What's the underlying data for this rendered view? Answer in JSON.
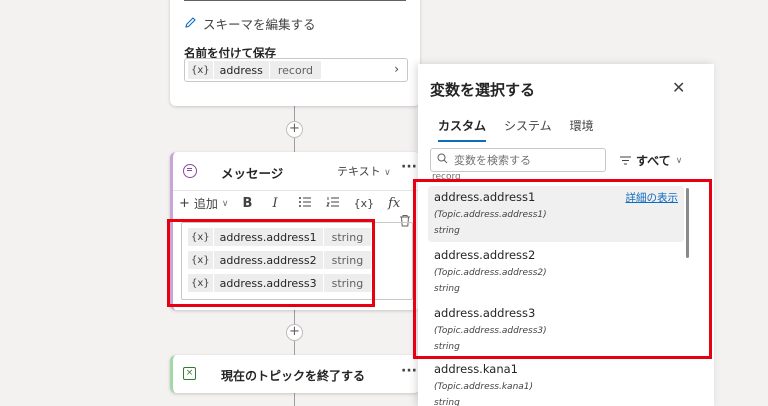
{
  "top_card": {
    "edit_schema_label": "スキーマを編集する",
    "save_as_label": "名前を付けて保存",
    "variable_icon": "{x}",
    "variable_name": "address",
    "variable_type": "record"
  },
  "message_card": {
    "title": "メッセージ",
    "type_selector": "テキスト",
    "more": "···",
    "toolbar": {
      "add_label": "追加",
      "bold": "B",
      "italic": "I",
      "variable": "{x}",
      "formula": "fx"
    },
    "variables": [
      {
        "icon": "{x}",
        "name": "address.address1",
        "type": "string"
      },
      {
        "icon": "{x}",
        "name": "address.address2",
        "type": "string"
      },
      {
        "icon": "{x}",
        "name": "address.address3",
        "type": "string"
      }
    ]
  },
  "end_card": {
    "title": "現在のトピックを終了する",
    "more": "···"
  },
  "panel": {
    "title": "変数を選択する",
    "tabs": [
      "カスタム",
      "システム",
      "環境"
    ],
    "active_tab": "カスタム",
    "search_placeholder": "変数を検索する",
    "filter_label": "すべて",
    "cut_text": "record",
    "detail_link": "詳細の表示",
    "items": [
      {
        "name": "address.address1",
        "path": "(Topic.address.address1)",
        "type": "string"
      },
      {
        "name": "address.address2",
        "path": "(Topic.address.address2)",
        "type": "string"
      },
      {
        "name": "address.address3",
        "path": "(Topic.address.address3)",
        "type": "string"
      },
      {
        "name": "address.kana1",
        "path": "(Topic.address.kana1)",
        "type": "string"
      }
    ]
  },
  "colors": {
    "highlight": "#e60012",
    "accent": "#0f6cbd",
    "message_accent": "#c9a5d6",
    "end_accent": "#a5d6a7"
  }
}
